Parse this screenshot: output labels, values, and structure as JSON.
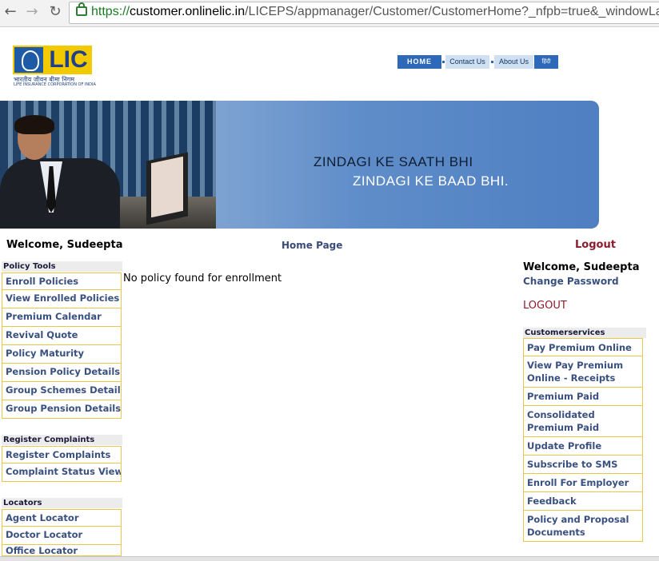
{
  "browser": {
    "url_scheme": "https://",
    "url_host": "customer.onlinelic.in",
    "url_path": "/LICEPS/appmanager/Customer/CustomerHome?_nfpb=true&_windowLa"
  },
  "logo": {
    "text": "LIC",
    "tagline_hindi": "भारतीय जीवन बीमा निगम",
    "tagline_en": "LIFE INSURANCE CORPORATION OF INDIA"
  },
  "topnav": {
    "home": "HOME",
    "contact": "Contact Us",
    "about": "About Us",
    "hindi": "हिंदी"
  },
  "banner": {
    "line1": "ZINDAGI KE SAATH BHI",
    "line2": "ZINDAGI KE BAAD BHI."
  },
  "welcome_bar": {
    "welcome": "Welcome, Sudeepta",
    "home_page": "Home Page",
    "logout": "Logout"
  },
  "left": {
    "policy_tools": {
      "title": "Policy Tools",
      "items": [
        "Enroll Policies",
        "View Enrolled Policies",
        "Premium Calendar",
        "Revival Quote",
        "Policy Maturity",
        "Pension Policy Details",
        "Group Schemes Details",
        "Group Pension Details"
      ]
    },
    "complaints": {
      "title": "Register Complaints",
      "items": [
        "Register Complaints",
        "Complaint Status View"
      ]
    },
    "locators": {
      "title": "Locators",
      "items": [
        "Agent Locator",
        "Doctor Locator",
        "Office Locator"
      ]
    }
  },
  "main": {
    "message": "No policy found for enrollment"
  },
  "right": {
    "welcome": "Welcome, Sudeepta",
    "change_password": "Change Password",
    "logout": "LOGOUT",
    "services_title": "Customerservices",
    "services": [
      "Pay Premium Online",
      "View Pay Premium Online - Receipts",
      "Premium Paid Statement",
      "Consolidated Premium Paid Statement",
      "Update Profile",
      "Subscribe to SMS",
      "Enroll For Employer",
      "Feedback",
      "Policy and Proposal Documents"
    ]
  },
  "colors": {
    "accent_blue": "#2d69b8",
    "link": "#3a5080",
    "logout": "#8b1c2c",
    "menu_border": "#e8c84a"
  }
}
